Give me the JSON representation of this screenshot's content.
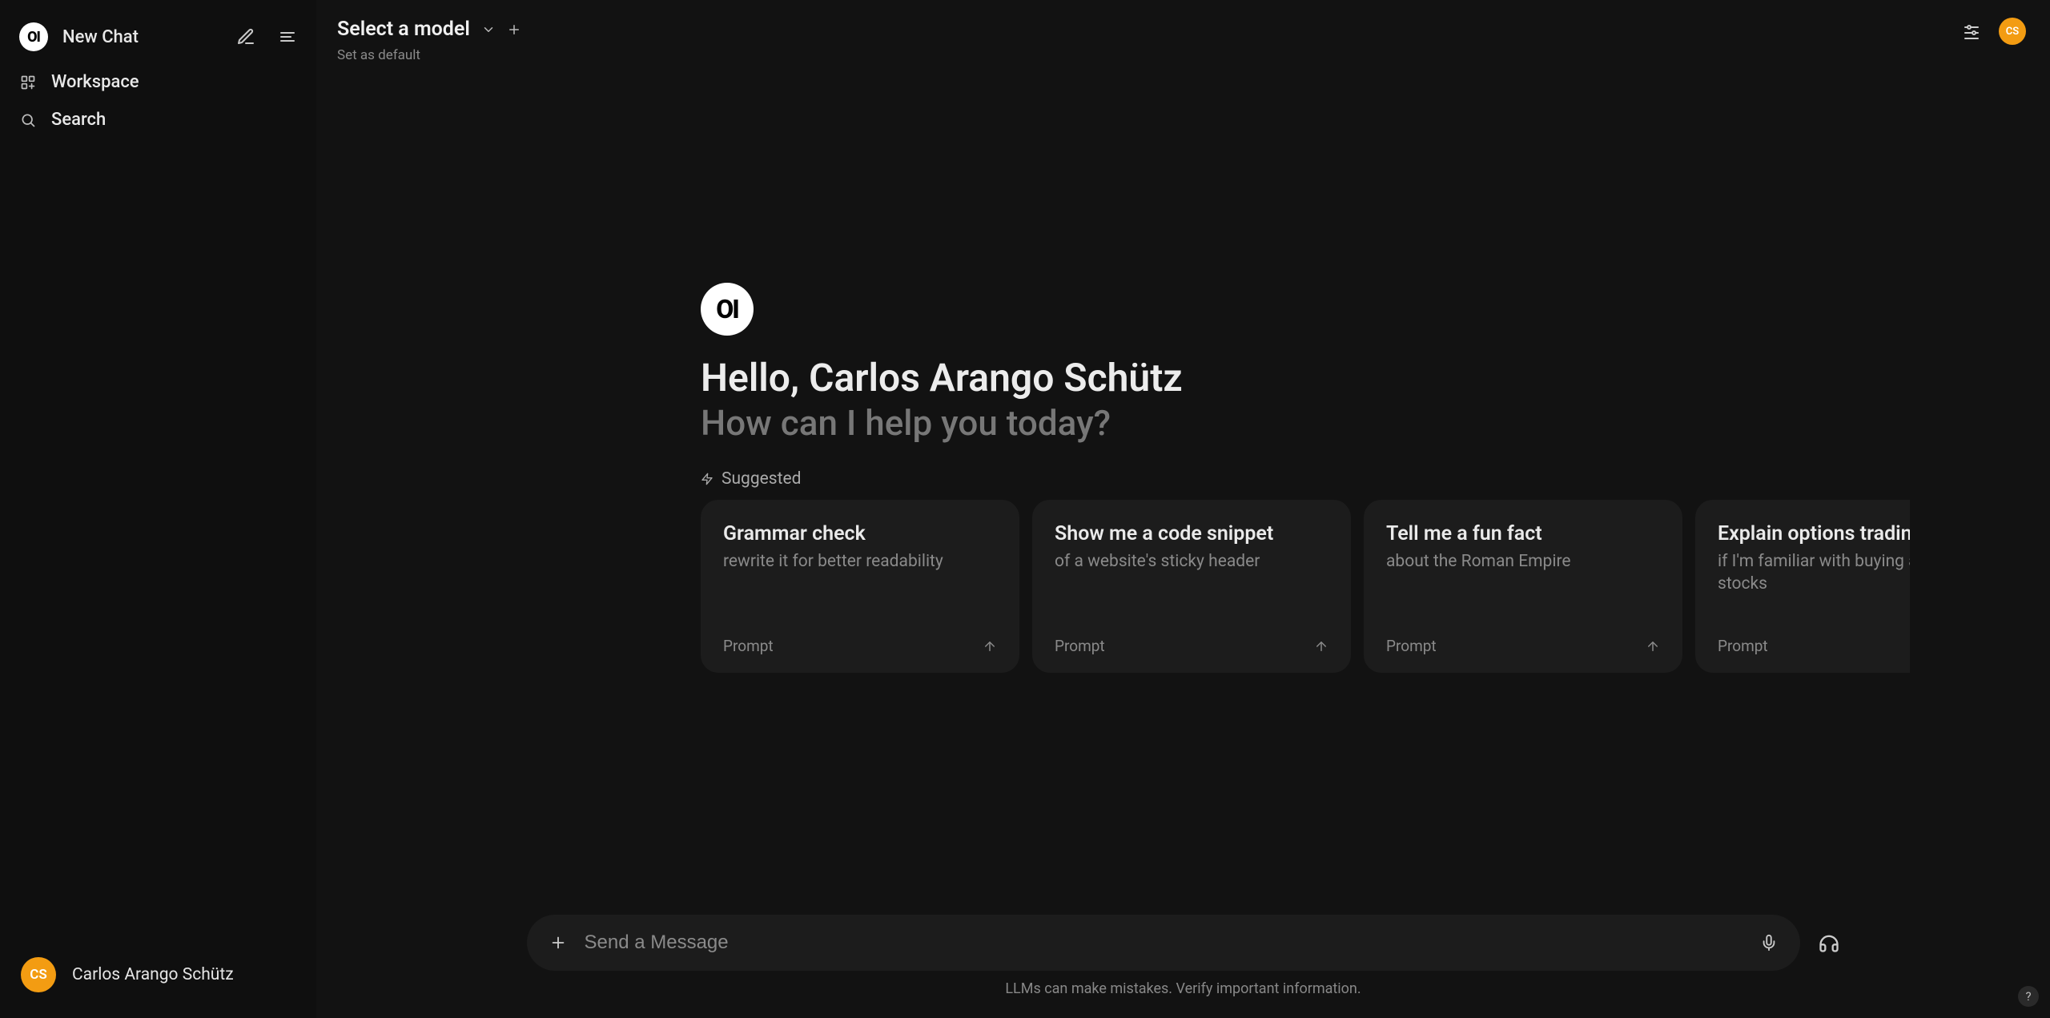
{
  "sidebar": {
    "new_chat": "New Chat",
    "workspace": "Workspace",
    "search": "Search"
  },
  "user": {
    "name": "Carlos Arango Schütz",
    "initials": "CS"
  },
  "topbar": {
    "select_model": "Select a model",
    "set_default": "Set as default"
  },
  "greeting": {
    "hello": "Hello, Carlos Arango Schütz",
    "sub": "How can I help you today?",
    "suggested": "Suggested"
  },
  "cards": [
    {
      "title": "Grammar check",
      "sub": "rewrite it for better readability",
      "tag": "Prompt"
    },
    {
      "title": "Show me a code snippet",
      "sub": "of a website's sticky header",
      "tag": "Prompt"
    },
    {
      "title": "Tell me a fun fact",
      "sub": "about the Roman Empire",
      "tag": "Prompt"
    },
    {
      "title": "Explain options trading",
      "sub": "if I'm familiar with buying and selling stocks",
      "tag": "Prompt"
    }
  ],
  "input": {
    "placeholder": "Send a Message"
  },
  "footer": {
    "disclaimer": "LLMs can make mistakes. Verify important information."
  },
  "help": "?"
}
